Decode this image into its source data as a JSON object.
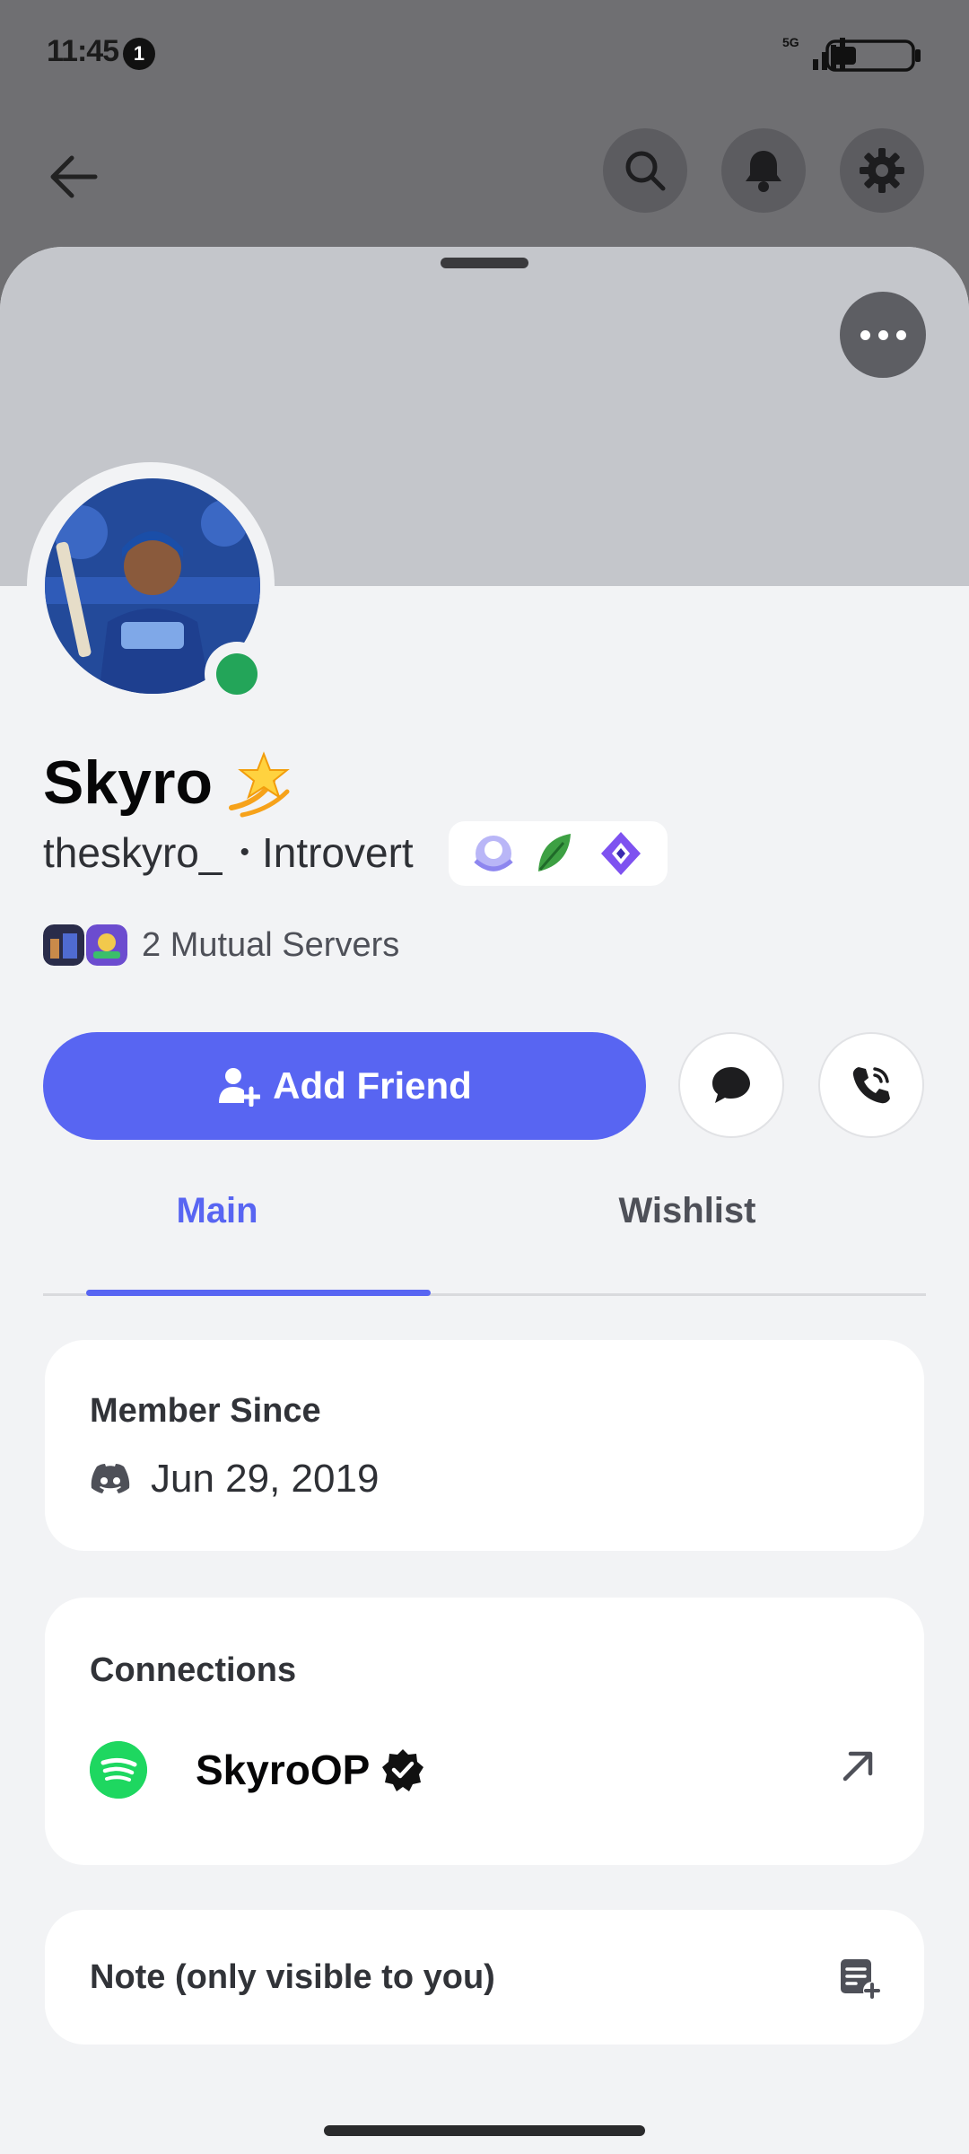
{
  "status_bar": {
    "time": "11:45",
    "notification_count": "1",
    "network_label": "5G"
  },
  "header": {
    "back_icon": "arrow-left-icon",
    "search_icon": "search-icon",
    "bell_icon": "bell-icon",
    "settings_icon": "gear-icon"
  },
  "profile": {
    "display_name": "Skyro",
    "username": "theskyro_",
    "separator": "•",
    "pronouns_status": "Introvert",
    "mutual_servers": "2 Mutual Servers",
    "online_color": "#23a559"
  },
  "actions": {
    "add_friend_label": "Add Friend",
    "message_icon": "chat-bubble-icon",
    "call_icon": "phone-call-icon",
    "accent_color": "#5865f2"
  },
  "tabs": [
    {
      "label": "Main",
      "active": true
    },
    {
      "label": "Wishlist",
      "active": false
    }
  ],
  "member_since": {
    "title": "Member Since",
    "date": "Jun 29, 2019"
  },
  "connections": {
    "title": "Connections",
    "items": [
      {
        "service": "spotify",
        "name": "SkyroOP",
        "verified": true
      }
    ]
  },
  "note": {
    "label": "Note (only visible to you)"
  }
}
